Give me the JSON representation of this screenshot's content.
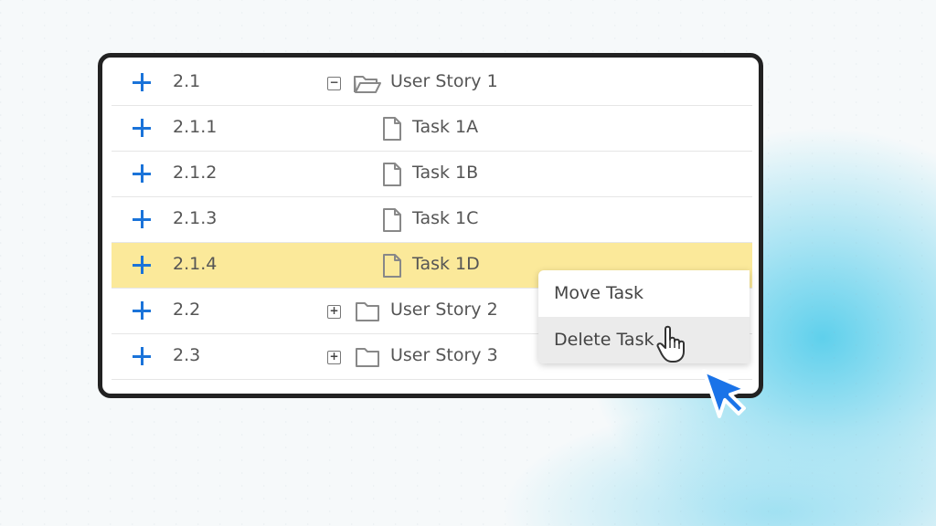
{
  "rows": [
    {
      "num": "2.1",
      "label": "User Story 1",
      "type": "folder",
      "expanded": true
    },
    {
      "num": "2.1.1",
      "label": "Task 1A",
      "type": "task"
    },
    {
      "num": "2.1.2",
      "label": "Task 1B",
      "type": "task"
    },
    {
      "num": "2.1.3",
      "label": "Task 1C",
      "type": "task"
    },
    {
      "num": "2.1.4",
      "label": "Task 1D",
      "type": "task",
      "selected": true
    },
    {
      "num": "2.2",
      "label": "User Story 2",
      "type": "folder",
      "expanded": false
    },
    {
      "num": "2.3",
      "label": "User Story 3",
      "type": "folder",
      "expanded": false
    }
  ],
  "context_menu": {
    "items": [
      {
        "label": "Move Task"
      },
      {
        "label": "Delete Task",
        "hovered": true
      }
    ]
  },
  "colors": {
    "accent": "#1a73d9",
    "selected_row": "#fbe99a",
    "frame": "#222222"
  },
  "toggles": {
    "expanded": "−",
    "collapsed": "+"
  }
}
